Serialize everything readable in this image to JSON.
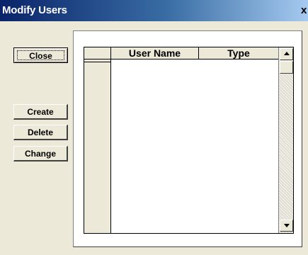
{
  "window": {
    "title": "Modify Users",
    "close_glyph": "x",
    "titlebar_colors": [
      "#0a246a",
      "#a6caf0"
    ]
  },
  "buttons": {
    "close": "Close",
    "create": "Create",
    "delete": "Delete",
    "change": "Change"
  },
  "table": {
    "columns": [
      "User Name",
      "Type"
    ],
    "rows": []
  },
  "icons": {
    "scroll_up": "triangle-up",
    "scroll_down": "triangle-down"
  }
}
